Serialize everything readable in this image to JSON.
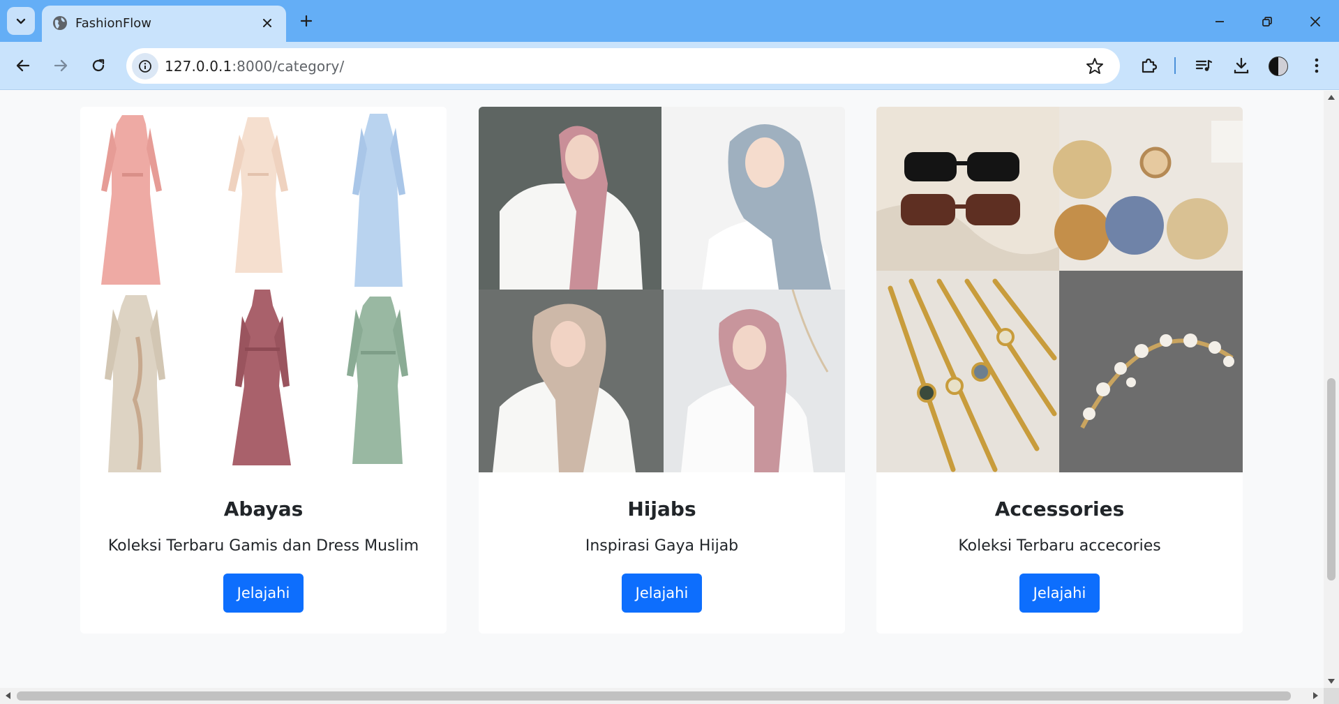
{
  "browser": {
    "tab": {
      "title": "FashionFlow"
    },
    "url": {
      "host": "127.0.0.1",
      "rest": ":8000/category/"
    }
  },
  "colors": {
    "accent": "#0d6efd",
    "tabbar": "#64aef6",
    "toolbar": "#c9e3fc"
  },
  "cards": [
    {
      "title": "Abayas",
      "text": "Koleksi Terbaru Gamis dan Dress Muslim",
      "button": "Jelajahi",
      "image": "abaya-collage"
    },
    {
      "title": "Hijabs",
      "text": "Inspirasi Gaya Hijab",
      "button": "Jelajahi",
      "image": "hijab-collage"
    },
    {
      "title": "Accessories",
      "text": "Koleksi Terbaru accecories",
      "button": "Jelajahi",
      "image": "accessories-collage"
    }
  ]
}
